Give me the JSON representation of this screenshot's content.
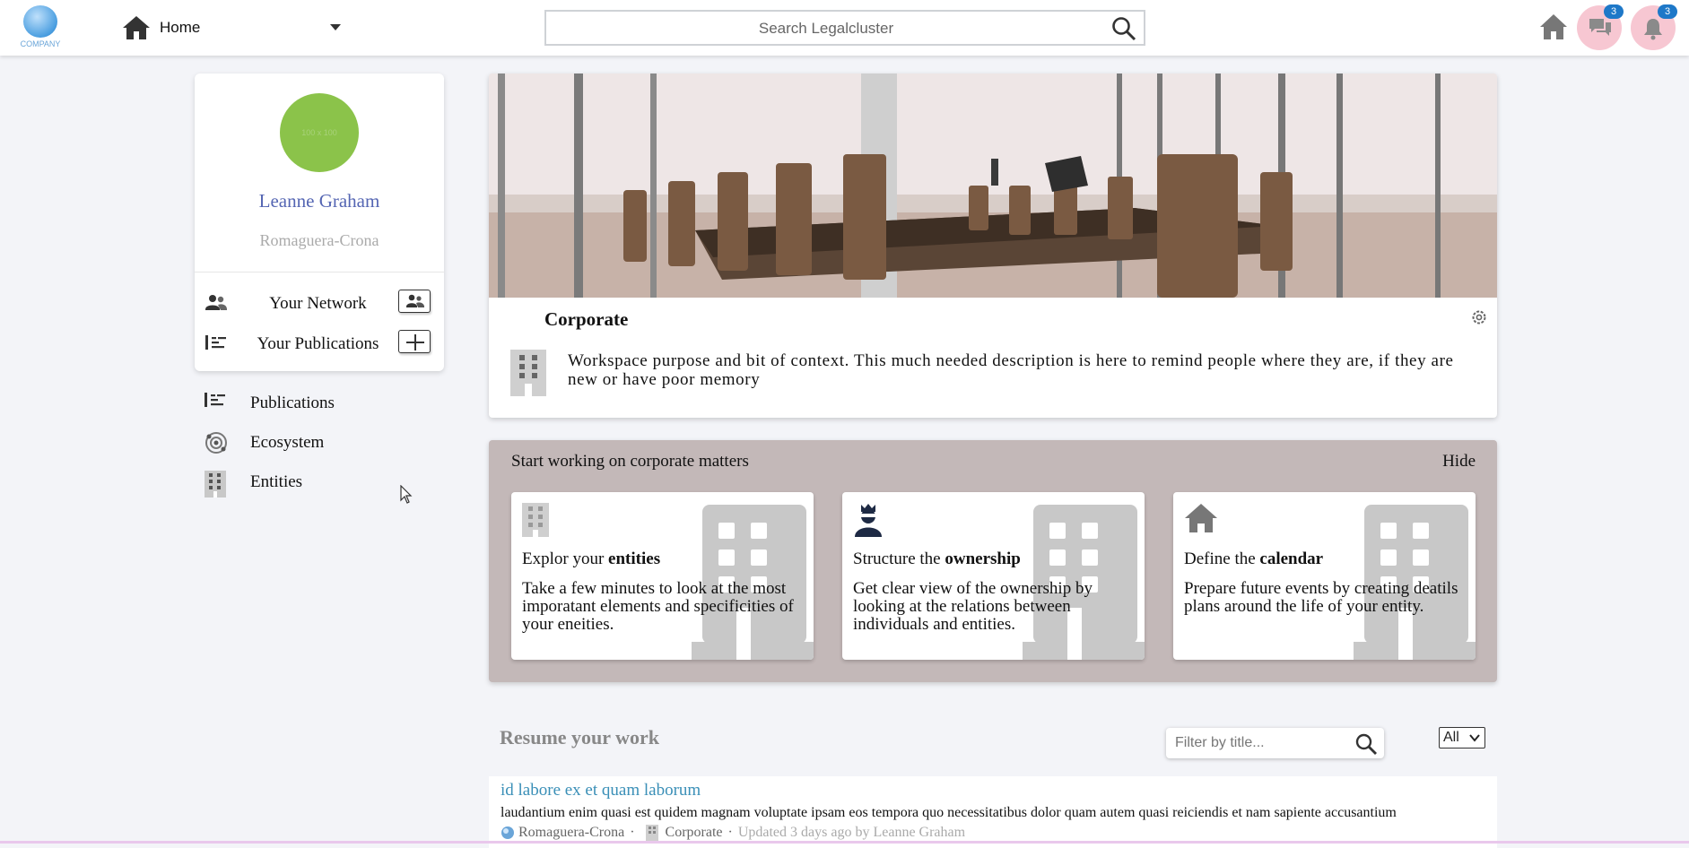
{
  "topbar": {
    "logo_text": "COMPANY",
    "home_label": "Home",
    "search_placeholder": "Search Legalcluster",
    "messages_badge": "3",
    "notifications_badge": "3"
  },
  "profile": {
    "avatar_text": "100 x 100",
    "name": "Leanne Graham",
    "company": "Romaguera-Crona",
    "network_label": "Your Network",
    "publications_label": "Your Publications"
  },
  "sidebar": {
    "items": [
      {
        "label": "Publications",
        "icon": "list-icon"
      },
      {
        "label": "Ecosystem",
        "icon": "ecosystem-icon"
      },
      {
        "label": "Entities",
        "icon": "building-icon"
      }
    ]
  },
  "workspace": {
    "title": "Corporate",
    "description": "Workspace purpose and bit of context. This much needed description is here to remind people where they are, if they are new or have poor memory"
  },
  "start": {
    "title": "Start working on corporate matters",
    "hide_label": "Hide",
    "cards": [
      {
        "prefix": "Explor your ",
        "bold": "entities",
        "desc": "Take a few minutes to look at the most imporatant elements and specificities of your eneities.",
        "icon": "building-icon"
      },
      {
        "prefix": "Structure the ",
        "bold": "ownership",
        "desc": "Get clear view of the ownership by looking at the relations between individuals and entities.",
        "icon": "person-icon"
      },
      {
        "prefix": "Define the ",
        "bold": "calendar",
        "desc": "Prepare future events by creating deatils plans around the life of your entity.",
        "icon": "home-icon"
      }
    ]
  },
  "resume": {
    "title": "Resume your work",
    "filter_placeholder": "Filter by title...",
    "select_value": "All",
    "items": [
      {
        "title": "id labore ex et quam laborum",
        "text": "laudantium enim quasi est quidem magnam voluptate ipsam eos tempora quo necessitatibus dolor quam autem quasi reiciendis et nam sapiente accusantium",
        "company": "Romaguera-Crona",
        "separator": "·",
        "workspace": "Corporate",
        "updated": "Updated 3 days ago by Leanne Graham"
      }
    ]
  },
  "colors": {
    "accent": "#5566b3",
    "link": "#3a8fb7",
    "avatar": "#8bc34a",
    "badge": "#1e78c8",
    "panel": "#c3b8b8"
  }
}
